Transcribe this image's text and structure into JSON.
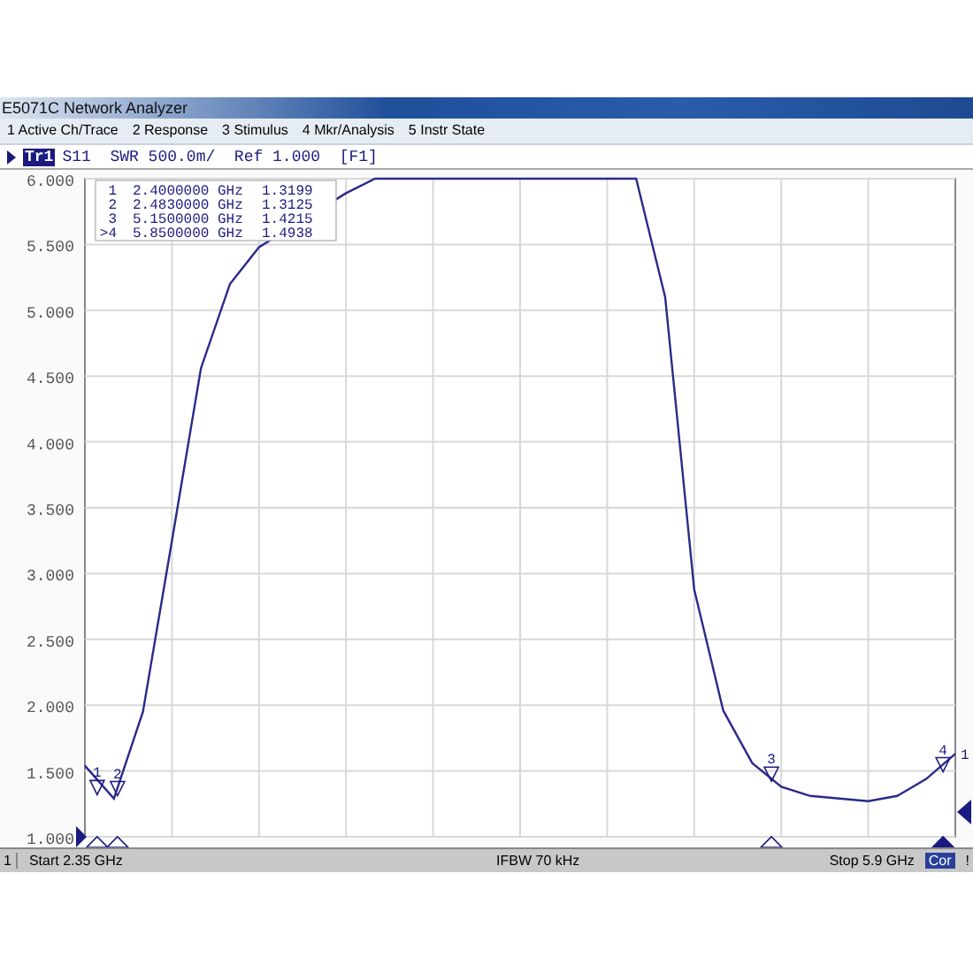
{
  "window": {
    "title": "E5071C Network Analyzer"
  },
  "menu": [
    "1 Active Ch/Trace",
    "2 Response",
    "3 Stimulus",
    "4 Mkr/Analysis",
    "5 Instr State"
  ],
  "trace_header": {
    "trace": "Tr1",
    "text": "S11  SWR 500.0m/  Ref 1.000  [F1]"
  },
  "markers": [
    {
      "label": "1",
      "frequency": "2.4000000 GHz",
      "value": "1.3199",
      "active": false,
      "tag": "1"
    },
    {
      "label": "2",
      "frequency": "2.4830000 GHz",
      "value": "1.3125",
      "active": false,
      "tag": "2"
    },
    {
      "label": "3",
      "frequency": "5.1500000 GHz",
      "value": "1.4215",
      "active": false,
      "tag": "3"
    },
    {
      "label": ">4",
      "frequency": "5.8500000 GHz",
      "value": "1.4938",
      "active": true,
      "tag": "4"
    }
  ],
  "trace_label": "1",
  "chart_data": {
    "type": "line",
    "grid": true,
    "ylim": [
      1,
      6
    ],
    "yticks": [
      {
        "value": 1,
        "label": "1.000"
      },
      {
        "value": 1.5,
        "label": "1.500"
      },
      {
        "value": 2,
        "label": "2.000"
      },
      {
        "value": 2.5,
        "label": "2.500"
      },
      {
        "value": 3,
        "label": "3.000"
      },
      {
        "value": 3.5,
        "label": "3.500"
      },
      {
        "value": 4,
        "label": "4.000"
      },
      {
        "value": 4.5,
        "label": "4.500"
      },
      {
        "value": 5,
        "label": "5.000"
      },
      {
        "value": 5.5,
        "label": "5.500"
      },
      {
        "value": 6,
        "label": "6.000"
      }
    ],
    "categories": [
      null,
      null,
      null,
      null,
      null,
      null,
      null,
      null,
      null,
      null,
      null,
      null,
      null,
      null,
      null,
      null,
      null,
      null,
      null,
      null,
      null,
      null,
      null,
      null,
      null,
      null,
      null,
      null,
      null,
      null,
      null
    ],
    "series": [
      {
        "color": "#2a2a8a",
        "values": [
          1.54,
          1.29,
          1.95,
          3.25,
          4.56,
          5.2,
          5.48,
          null,
          null,
          5.89,
          6,
          6,
          6,
          6,
          6,
          6,
          6,
          6,
          6,
          6,
          5.1,
          2.88,
          1.96,
          1.56,
          1.38,
          1.31,
          1.29,
          1.27,
          1.31,
          1.44,
          1.63
        ]
      }
    ]
  },
  "status_bar": {
    "channel": "1",
    "start": "Start 2.35 GHz",
    "ifbw": "IFBW 70 kHz",
    "stop": "Stop 5.9 GHz",
    "correction": "Cor",
    "warning": "!"
  }
}
